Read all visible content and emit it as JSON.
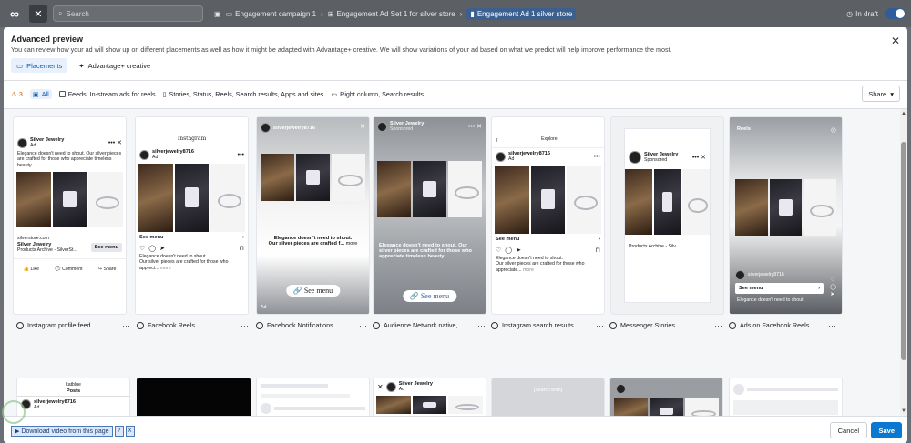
{
  "topbar": {
    "search_placeholder": "Search",
    "breadcrumbs": [
      "Engagement campaign 1",
      "Engagement Ad Set 1 for silver store",
      "Engagement Ad 1 silver store"
    ],
    "status": "In draft"
  },
  "modal": {
    "title": "Advanced preview",
    "description": "You can review how your ad will show up on different placements as well as how it might be adapted with Advantage+ creative. We will show variations of your ad based on what we predict will help improve performance the most.",
    "tabs": [
      {
        "label": "Placements",
        "active": true
      },
      {
        "label": "Advantage+ creative",
        "active": false
      }
    ]
  },
  "filters": {
    "warnings": "3",
    "items": [
      "All",
      "Feeds, In-stream ads for reels",
      "Stories, Status, Reels, Search results, Apps and sites",
      "Right column, Search results"
    ],
    "share_label": "Share"
  },
  "cards_row1": {
    "fb_feed": {
      "page": "Silver Jewelry",
      "sub": "Ad",
      "body": "Elegance doesn't need to shout. Our silver pieces are crafted for those who appreciate timeless beauty",
      "domain": "silverstore.com",
      "headline": "Silver Jewelry",
      "desc": "Products Archive - SilverSt...",
      "cta": "See menu",
      "actions": [
        "Like",
        "Comment",
        "Share"
      ]
    },
    "ig_feed": {
      "brand": "Instagram",
      "handle": "silverjewelry8716",
      "sub": "Ad",
      "cta": "See menu",
      "caption": "Elegance doesn't need to shout.",
      "caption2": "Our silver pieces are crafted for those who appreci...",
      "more": "more"
    },
    "fb_story": {
      "handle": "silverjewelry8716",
      "body": "Elegance doesn't need to shout.",
      "body2": "Our silver pieces are crafted f...",
      "more": "more",
      "cta": "See menu",
      "tag": "Ad"
    },
    "ig_story": {
      "handle": "Silver Jewelry",
      "sub": "Sponsored",
      "body": "Elegance doesn't need to shout. Our silver pieces are crafted for those who appreciate timeless beauty",
      "cta": "See menu"
    },
    "ig_explore": {
      "title": "Explore",
      "handle": "silverjewelry8716",
      "sub": "Ad",
      "cta": "See menu",
      "caption": "Elegance doesn't need to shout.",
      "caption2": "Our silver pieces are crafted for those who appreciate...",
      "more": "more"
    },
    "fb_marketplace": {
      "page": "Silver Jewelry",
      "sub": "Sponsored",
      "desc": "Products Archive - Silv..."
    },
    "fb_reels": {
      "title": "Reels",
      "handle": "silverjewelry8716",
      "body": "Elegance doesn't need to shout",
      "cta": "See menu"
    }
  },
  "placement_labels": [
    "Instagram profile feed",
    "Facebook Reels",
    "Facebook Notifications",
    "Audience Network native, ...",
    "Instagram search results",
    "Messenger Stories",
    "Ads on Facebook Reels"
  ],
  "cards_row2": {
    "ig_profile": {
      "user": "katblue",
      "title": "Posts",
      "handle": "silverjewelry8716",
      "sub": "Ad"
    },
    "an_native": {
      "page": "Silver Jewelry",
      "sub": "Ad"
    },
    "ig_search": {
      "label": "[Search term]"
    }
  },
  "footer": {
    "cancel": "Cancel",
    "save": "Save"
  },
  "download_bar": {
    "label": "Download video from this page",
    "help": "?",
    "close": "X"
  }
}
